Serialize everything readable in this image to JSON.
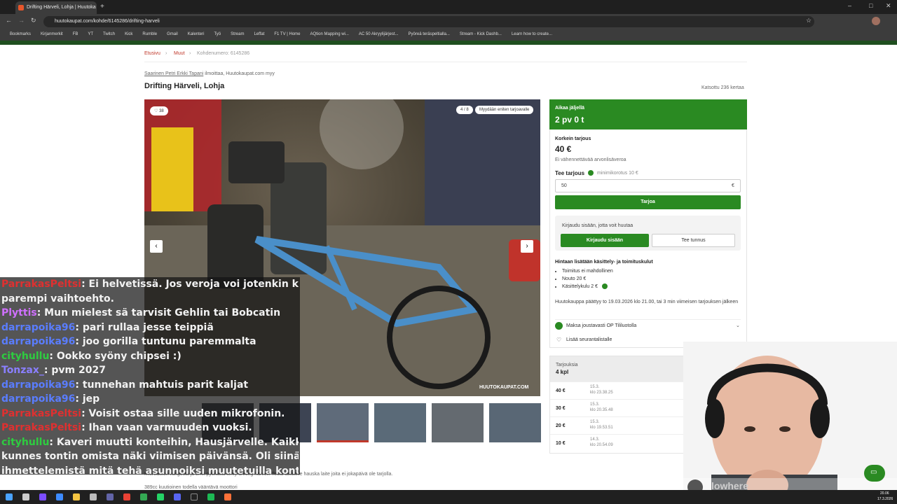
{
  "browser": {
    "tab_title": "Drifting Härveli, Lohja | Huutoka",
    "url": "huutokaupat.com/kohde/6145286/drifting-harveli",
    "bookmarks": [
      "Bookmarks",
      "Kirjanmerkit",
      "FB",
      "YT",
      "Twitch",
      "Kick",
      "Rumble",
      "Gmail",
      "Kalenteri",
      "Työ",
      "Stream",
      "Leffat",
      "F1 TV | Home",
      "AQtion Mapping wi...",
      "AC 50 Akryylijärjest...",
      "Pyöreä teräspeltialla...",
      "Stream - Kick Dashb...",
      "Learn how to create..."
    ]
  },
  "breadcrumb": {
    "home": "Etusivu",
    "category": "Muut",
    "item_number": "Kohdenumero: 6145286"
  },
  "listing": {
    "seller_name": "Saarinen Petri Erkki Tapani",
    "seller_suffix": "ilmoittaa, Huutokaupat.com myy",
    "title": "Drifting Härveli, Lohja",
    "views": "Katsottu 236 kertaa",
    "likes": "38",
    "photo_counter": "4 / 8",
    "photo_badge": "Myydään eniten tarjoavalle",
    "watermark": "HUUTOKAUPAT.COM",
    "description_line1": "Microauton rungosta ja bmx pyörästä tehty drifting härveli. Testa asfaltille hauska laite joita ei jokapäivä ole tarjolla.",
    "description_line2": "389cc kuutioinen todella vääntävä moottori"
  },
  "panel": {
    "time_label": "Aikaa jäljellä",
    "time_value": "2 pv 0 t",
    "highest_label": "Korkein tarjous",
    "highest_value": "40 €",
    "vat_note": "Ei vähennettävää arvonlisäveroa",
    "bid_label": "Tee tarjous",
    "min_raise": "minimikorotus 10 €",
    "bid_input_value": "50",
    "currency": "€",
    "bid_button": "Tarjoa",
    "login_prompt": "Kirjaudu sisään, jotta voit huutaa",
    "login_button": "Kirjaudu sisään",
    "register_button": "Tee tunnus",
    "fees_title": "Hintaan lisätään käsittely- ja toimituskulut",
    "fees": [
      "Toimitus ei mahdollinen",
      "Nouto 20 €",
      "Käsittelykulu 2 €"
    ],
    "end_note": "Huutokauppa päättyy to 19.03.2026 klo 21.00, tai 3 min viimeisen tarjouksen jälkeen",
    "op_pay": "Maksa joustavasti OP Tililuotolla",
    "watchlist": "Lisää seurantalistalle"
  },
  "bids": {
    "header_label": "Tarjouksia",
    "header_count": "4 kpl",
    "rows": [
      {
        "amount": "40 €",
        "date": "15.3.",
        "time": "klo 23.38.25"
      },
      {
        "amount": "30 €",
        "date": "15.3.",
        "time": "klo 20.35.48"
      },
      {
        "amount": "20 €",
        "date": "15.3.",
        "time": "klo 19.53.51"
      },
      {
        "amount": "10 €",
        "date": "14.3.",
        "time": "klo 20.54.09"
      }
    ]
  },
  "chat": [
    {
      "user": "ParrakasPeltsi",
      "text": ": Ei helvetissä. Jos veroja voi jotenkin kiertää ni aina",
      "color": "#e03030"
    },
    {
      "user": "",
      "text": "parempi vaihtoehto.",
      "color": "#e03030"
    },
    {
      "user": "Plyttis",
      "text": ": Mun mielest sä tarvisit Gehlin tai Bobcatin",
      "color": "#d070ff"
    },
    {
      "user": "darrapoika96",
      "text": ": pari rullaa jesse teippiä",
      "color": "#5a7dff"
    },
    {
      "user": "darrapoika96",
      "text": ": joo gorilla tuntunu paremmalta",
      "color": "#5a7dff"
    },
    {
      "user": "cityhullu",
      "text": ": Ookko syöny chipsei :)",
      "color": "#2ecc40"
    },
    {
      "user": "Tonzax_",
      "text": ": pvm 2027",
      "color": "#8a7fff"
    },
    {
      "user": "darrapoika96",
      "text": ": tunnehan mahtuis parit kaljat",
      "color": "#5a7dff"
    },
    {
      "user": "darrapoika96",
      "text": ": jep",
      "color": "#5a7dff"
    },
    {
      "user": "ParrakasPeltsi",
      "text": ": Voisit ostaa sille uuden mikrofonin.",
      "color": "#e03030"
    },
    {
      "user": "ParrakasPeltsi",
      "text": ": Ihan vaan varmuuden vuoksi.",
      "color": "#e03030"
    },
    {
      "user": "cityhullu",
      "text": ": Kaveri muutti konteihin, Hausjärvelle. Kaikki suju hyvin",
      "color": "#2ecc40"
    },
    {
      "user": "",
      "text": "kunnes tontin omista näki viimisen päivänsä. Oli siinä",
      "color": "#2ecc40"
    },
    {
      "user": "",
      "text": "ihmettelemistä mitä tehä asunnoiksi muutetuilla konteilla.",
      "color": "#2ecc40"
    }
  ],
  "webcam_overlay_name": "lowhere",
  "taskbar": {
    "time": "20.06",
    "date": "17.3.2026"
  },
  "colors": {
    "brand_green": "#2a8a22",
    "brand_red": "#c0392b"
  }
}
